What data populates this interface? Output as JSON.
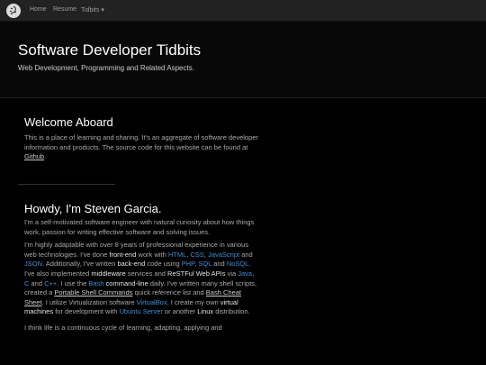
{
  "nav": {
    "brand_icon": "lizard-logo-icon",
    "items": [
      {
        "label": "Home"
      },
      {
        "label": "Resume"
      },
      {
        "label": "Tidbits"
      }
    ],
    "dropdown_caret": "▾"
  },
  "hero": {
    "title": "Software Developer Tidbits",
    "subtitle": "Web Development, Programming and Related Aspects."
  },
  "welcome": {
    "heading": "Welcome Aboard",
    "text_before": "This is a place of learning and sharing. It's an aggregate of software developer information and products. The source code for this website can be found at ",
    "github_link": "Github",
    "text_after": "."
  },
  "about": {
    "heading": "Howdy, I'm Steven Garcia.",
    "intro": "I'm a self-motivated software engineer with natural curiosity about how things work, passion for writing effective software and solving issues.",
    "p2": {
      "t1": "I'm highly adaptable with over 8 years of professional experience in various web technologies. I've done ",
      "frontend": "front-end",
      "t2": " work with ",
      "html": "HTML",
      "t3": ", ",
      "css": "CSS",
      "t4": ", ",
      "javascript": "JavaScript",
      "t5": " and ",
      "json": "JSON",
      "t6": ". Additionally, I've written ",
      "backend": "back-end",
      "t7": " code using ",
      "php": "PHP",
      "t8": ", ",
      "sql": "SQL",
      "t9": " and ",
      "nosql": "NoSQL",
      "t10": ". I've also implemented ",
      "middleware": "middleware",
      "t11": " services and ",
      "restful": "ReSTFul Web APIs",
      "t12": " via ",
      "java": "Java",
      "t13": ", ",
      "c": "C",
      "t14": " and ",
      "cpp": "C++",
      "t15": ". I use the ",
      "bash": "Bash",
      "t16": " ",
      "commandline": "command-line",
      "t17": " daily. I've written many shell scripts, created a ",
      "portable_shell": "Portable Shell Commands",
      "t18": " quick reference list and ",
      "bash_cheat": "Bash Cheat Sheet",
      "t19": ". I utilize Virtualization software ",
      "virtualbox": "VirtualBox",
      "t20": ". I create my own ",
      "vms": "virtual machines",
      "t21": " for development with ",
      "ubuntu": "Ubuntu Server",
      "t22": " or another ",
      "linux": "Linux",
      "t23": " distribution."
    },
    "p3": "I think life is a continuous cycle of learning, adapting, applying and"
  },
  "colors": {
    "link": "#3d8fd9",
    "background": "#000000",
    "navbar": "#222222"
  }
}
